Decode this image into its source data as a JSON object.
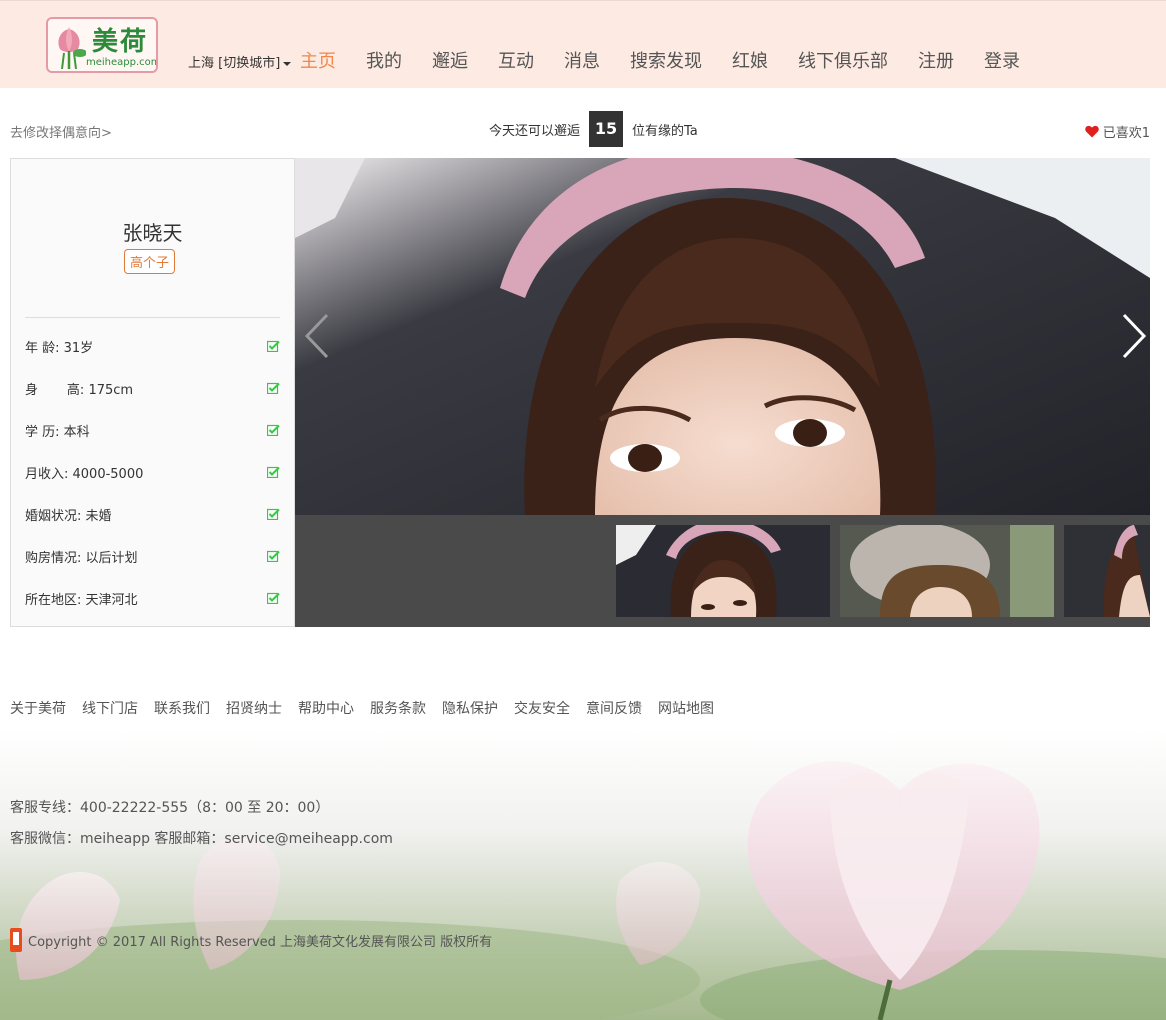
{
  "header": {
    "logo_text": "美荷",
    "logo_url": "meiheapp.com",
    "city": "上海 [切换城市]",
    "nav": [
      {
        "label": "主页",
        "active": true
      },
      {
        "label": "我的",
        "active": false
      },
      {
        "label": "邂逅",
        "active": false
      },
      {
        "label": "互动",
        "active": false
      },
      {
        "label": "消息",
        "active": false
      },
      {
        "label": "搜索发现",
        "active": false
      },
      {
        "label": "红娘",
        "active": false
      },
      {
        "label": "线下俱乐部",
        "active": false
      },
      {
        "label": "注册",
        "active": false
      },
      {
        "label": "登录",
        "active": false
      }
    ]
  },
  "toolbar": {
    "modify_link": "去修改择偶意向>",
    "meet_prefix": "今天还可以邂逅",
    "meet_count": "15",
    "meet_suffix": "位有缘的Ta",
    "liked_label": "已喜欢1"
  },
  "profile": {
    "name": "张晓天",
    "tag": "高个子",
    "rows": [
      {
        "label": "年 龄: 31岁"
      },
      {
        "label": "身       高: 175cm"
      },
      {
        "label": "学 历: 本科"
      },
      {
        "label": "月收入: 4000-5000"
      },
      {
        "label": "婚姻状况: 未婚"
      },
      {
        "label": "购房情况: 以后计划"
      },
      {
        "label": "所在地区: 天津河北"
      }
    ]
  },
  "footer": {
    "links": [
      "关于美荷",
      "线下门店",
      "联系我们",
      "招贤纳士",
      "帮助中心",
      "服务条款",
      "隐私保护",
      "交友安全",
      "意间反馈",
      "网站地图"
    ],
    "hotline": "客服专线：400-22222-555（8：00 至 20：00）",
    "wechat": "客服微信：meiheapp 客服邮箱：service@meiheapp.com",
    "copyright": "Copyright © 2017 All Rights Reserved 上海美荷文化发展有限公司 版权所有"
  },
  "colors": {
    "header_bg": "#fdebe3",
    "accent": "#f0874d",
    "tag": "#e07b39",
    "check": "#2ecc40",
    "heart": "#e0201c"
  },
  "icons": [
    "lotus-logo-icon",
    "caret-down-icon",
    "heart-icon",
    "check-icon",
    "chevron-left-icon",
    "chevron-right-icon",
    "phone-icon"
  ]
}
